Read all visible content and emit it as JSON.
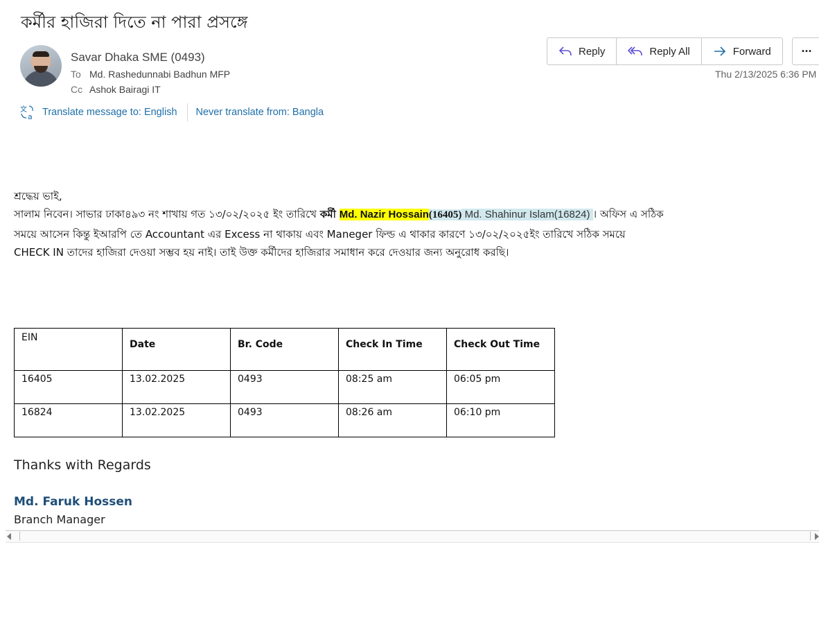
{
  "email": {
    "subject": "কর্মীর হাজিরা দিতে না পারা প্রসঙ্গে",
    "sender": "Savar Dhaka SME (0493)",
    "to_label": "To",
    "to": "Md. Rashedunnabi Badhun MFP",
    "cc_label": "Cc",
    "cc": "Ashok Bairagi IT",
    "date": "Thu 2/13/2025 6:36 PM"
  },
  "toolbar": {
    "reply": "Reply",
    "reply_all": "Reply All",
    "forward": "Forward",
    "more": "···"
  },
  "translate": {
    "to_english": "Translate message to: English",
    "never_bangla": "Never translate from: Bangla"
  },
  "body": {
    "greeting": "শ্রদ্ধেয় ভাই,",
    "line1_a": "সালাম নিবেন। সাভার ঢাকা৪৯৩ নং শাখায় গত ১৩/০২/২০২৫ ইং তারিখে ",
    "line1_b": "কর্মী",
    "name1": "Md. Nazir Hossain",
    "ein1": "(16405)",
    "name2": " Md. Shahinur Islam(16824) ",
    "line1_c": "। অফিস এ সঠিক",
    "line2": "সময়ে আসেন কিন্তু ইআরপি তে Accountant এর Excess না থাকায় এবং Maneger ফিল্ড এ থাকার কারণে ১৩/০২/২০২৫ইং তারিখে সঠিক সময়ে",
    "line3": "CHECK IN তাদের হাজিরা দেওয়া সম্ভব হয় নাই। তাই উক্ত কর্মীদের হাজিরার সমাধান করে দেওয়ার জন্য অনুরোধ করছি।"
  },
  "table": {
    "headers": [
      "EIN",
      "Date",
      "Br. Code",
      "Check In Time",
      "Check Out Time"
    ],
    "rows": [
      [
        "16405",
        "13.02.2025",
        "0493",
        "08:25 am",
        "06:05 pm"
      ],
      [
        "16824",
        "13.02.2025",
        "0493",
        "08:26 am",
        "06:10 pm"
      ]
    ]
  },
  "signature": {
    "closing": "Thanks with Regards",
    "name": "Md. Faruk Hossen",
    "title": "Branch Manager"
  }
}
